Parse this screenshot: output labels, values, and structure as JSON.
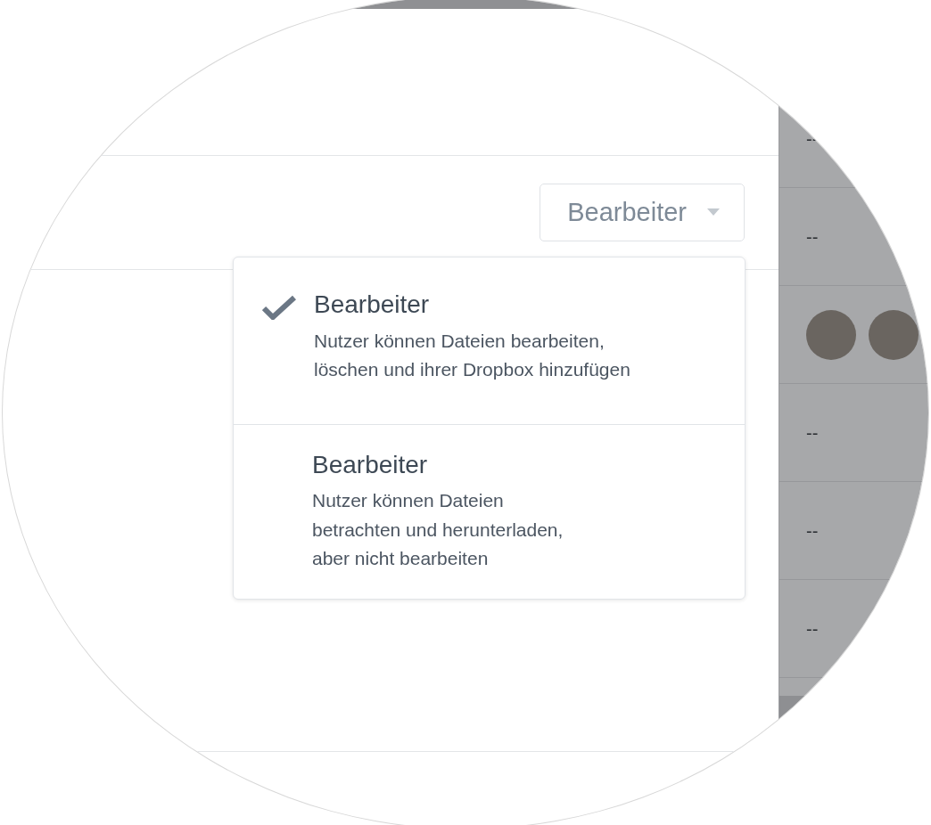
{
  "role_button": {
    "label": "Bearbeiter",
    "expanded": true
  },
  "role_menu": {
    "options": [
      {
        "title": "Bearbeiter",
        "description": "Nutzer können Dateien bearbeiten,\nlöschen und ihrer Dropbox hinzufügen",
        "selected": true
      },
      {
        "title": "Bearbeiter",
        "description": "Nutzer können Dateien\nbetrachten und herunterladen,\naber nicht bearbeiten",
        "selected": false
      }
    ]
  },
  "side_table": {
    "rows": [
      {
        "kind": "text",
        "text": "--"
      },
      {
        "kind": "text",
        "text": "--"
      },
      {
        "kind": "avatars"
      },
      {
        "kind": "text",
        "text": "--"
      },
      {
        "kind": "text",
        "text": "--"
      },
      {
        "kind": "text",
        "text": "--"
      }
    ]
  }
}
